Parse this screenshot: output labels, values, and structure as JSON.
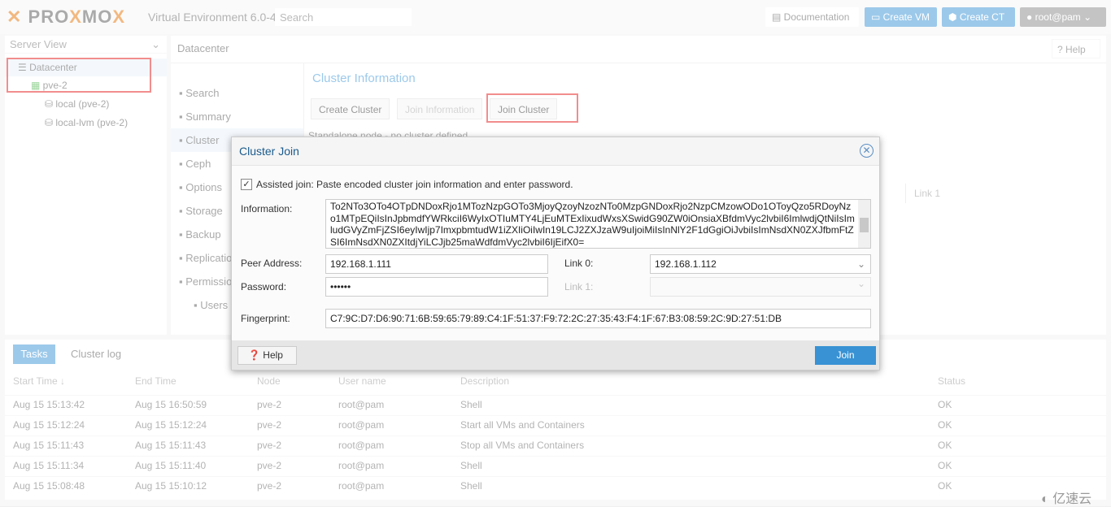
{
  "header": {
    "logo_text": "PROXMOX",
    "version": "Virtual Environment 6.0-4",
    "search_placeholder": "Search",
    "documentation": "Documentation",
    "create_vm": "Create VM",
    "create_ct": "Create CT",
    "user": "root@pam"
  },
  "tree": {
    "view": "Server View",
    "items": [
      {
        "label": "Datacenter"
      },
      {
        "label": "pve-2"
      },
      {
        "label": "local (pve-2)"
      },
      {
        "label": "local-lvm (pve-2)"
      }
    ]
  },
  "main": {
    "breadcrumb": "Datacenter",
    "help": "Help",
    "nav": [
      "Search",
      "Summary",
      "Cluster",
      "Ceph",
      "Options",
      "Storage",
      "Backup",
      "Replication",
      "Permissions",
      "Users"
    ],
    "cluster_info_title": "Cluster Information",
    "toolbar": {
      "create": "Create Cluster",
      "join_info": "Join Information",
      "join": "Join Cluster"
    },
    "standalone": "Standalone node - no cluster defined",
    "link1_col": "Link 1"
  },
  "tasks": {
    "tabs": [
      "Tasks",
      "Cluster log"
    ],
    "columns": [
      "Start Time ↓",
      "End Time",
      "Node",
      "User name",
      "Description",
      "Status"
    ],
    "rows": [
      [
        "Aug 15 15:13:42",
        "Aug 15 16:50:59",
        "pve-2",
        "root@pam",
        "Shell",
        "OK"
      ],
      [
        "Aug 15 15:12:24",
        "Aug 15 15:12:24",
        "pve-2",
        "root@pam",
        "Start all VMs and Containers",
        "OK"
      ],
      [
        "Aug 15 15:11:43",
        "Aug 15 15:11:43",
        "pve-2",
        "root@pam",
        "Stop all VMs and Containers",
        "OK"
      ],
      [
        "Aug 15 15:11:34",
        "Aug 15 15:11:40",
        "pve-2",
        "root@pam",
        "Shell",
        "OK"
      ],
      [
        "Aug 15 15:08:48",
        "Aug 15 15:10:12",
        "pve-2",
        "root@pam",
        "Shell",
        "OK"
      ]
    ]
  },
  "dialog": {
    "title": "Cluster Join",
    "assisted": "Assisted join: Paste encoded cluster join information and enter password.",
    "info_label": "Information:",
    "info_value": "To2NTo3OTo4OTpDNDoxRjo1MTozNzpGOTo3MjoyQzoyNzozNTo0MzpGNDoxRjo2NzpCMzowODo1OToyQzo5RDoyNzo1MTpEQiIsInJpbmdfYWRkciI6WyIxOTIuMTY4LjEuMTExIixudWxsXSwidG90ZW0iOnsiaXBfdmVyc2lvbiI6ImlwdjQtNiIsImludGVyZmFjZSI6eyIwIjp7ImxpbmtudW1iZXIiOiIwIn19LCJ2ZXJzaW9uIjoiMiIsInNlY2F1dGgiOiJvbiIsImNsdXN0ZXJfbmFtZSI6ImNsdXN0ZXItdjYiLCJjb25maWdfdmVyc2lvbiI6IjEifX0=",
    "peer_label": "Peer Address:",
    "peer_value": "192.168.1.111",
    "password_label": "Password:",
    "password_value": "••••••",
    "link0_label": "Link 0:",
    "link0_value": "192.168.1.112",
    "link1_label": "Link 1:",
    "fingerprint_label": "Fingerprint:",
    "fingerprint_value": "C7:9C:D7:D6:90:71:6B:59:65:79:89:C4:1F:51:37:F9:72:2C:27:35:43:F4:1F:67:B3:08:59:2C:9D:27:51:DB",
    "help": "Help",
    "join": "Join"
  },
  "watermark": "亿速云",
  "colors": {
    "accent": "#3892d4",
    "highlight": "#e51b1b",
    "brand_orange": "#e57000"
  }
}
